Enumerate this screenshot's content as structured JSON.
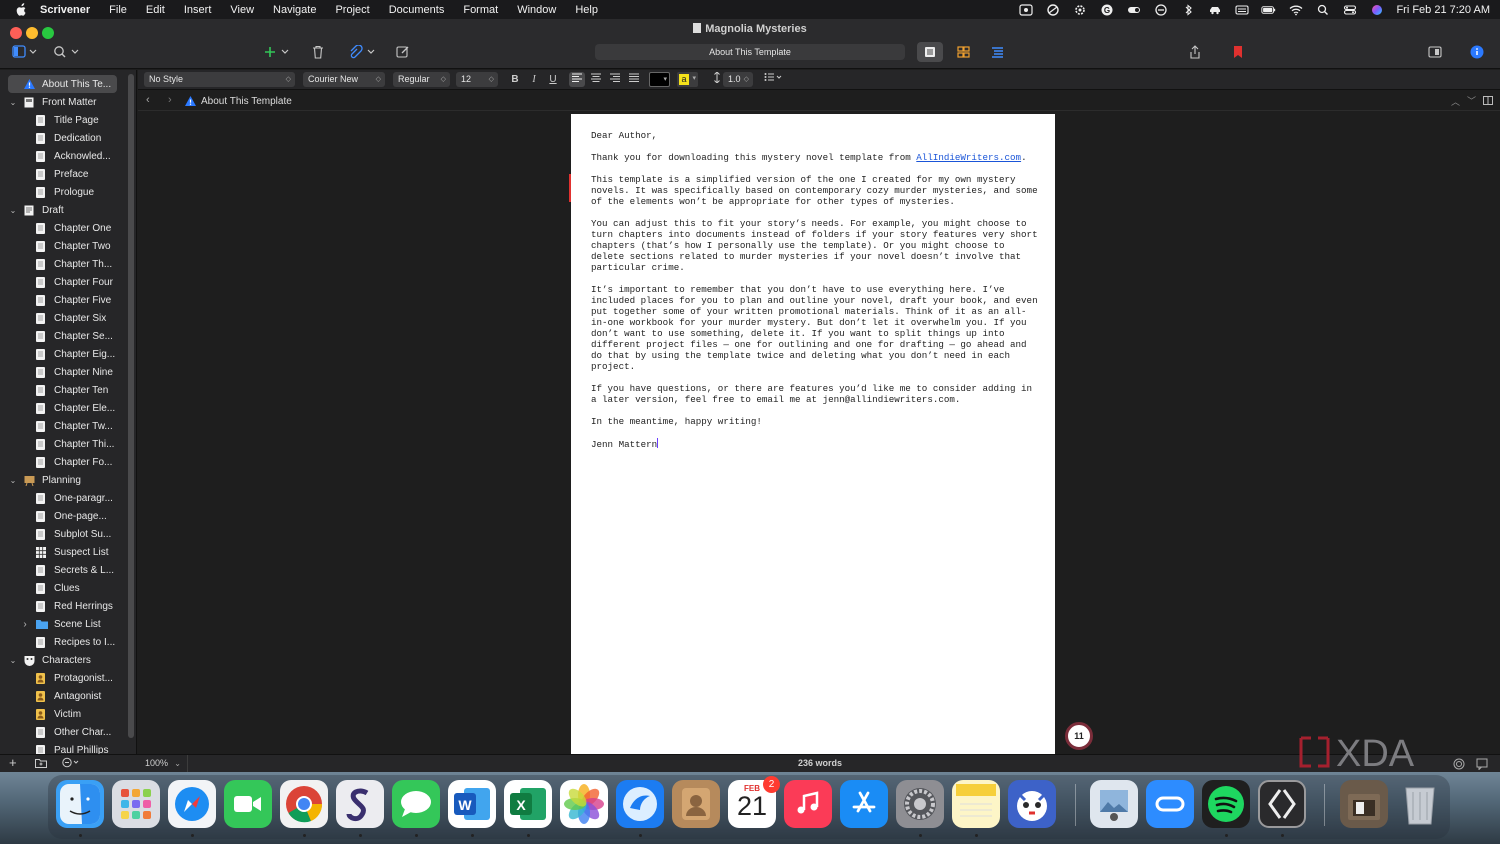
{
  "menubar": {
    "app_name": "Scrivener",
    "items": [
      "File",
      "Edit",
      "Insert",
      "View",
      "Navigate",
      "Project",
      "Documents",
      "Format",
      "Window",
      "Help"
    ],
    "clock": "Fri Feb 21  7:20 AM"
  },
  "window": {
    "title": "Magnolia Mysteries",
    "document_title": "About This Template"
  },
  "binder": {
    "items": [
      {
        "label": "About This Te...",
        "level": 0,
        "selected": true,
        "icon": "about-icon"
      },
      {
        "label": "Front Matter",
        "level": 0,
        "expanded": true,
        "icon": "folder-icon"
      },
      {
        "label": "Title Page",
        "level": 1,
        "icon": "document-icon"
      },
      {
        "label": "Dedication",
        "level": 1,
        "icon": "document-icon"
      },
      {
        "label": "Acknowled...",
        "level": 1,
        "icon": "document-icon"
      },
      {
        "label": "Preface",
        "level": 1,
        "icon": "document-icon"
      },
      {
        "label": "Prologue",
        "level": 1,
        "icon": "document-icon"
      },
      {
        "label": "Draft",
        "level": 0,
        "expanded": true,
        "icon": "draft-icon"
      },
      {
        "label": "Chapter One",
        "level": 1,
        "icon": "document-icon"
      },
      {
        "label": "Chapter Two",
        "level": 1,
        "icon": "document-icon"
      },
      {
        "label": "Chapter Th...",
        "level": 1,
        "icon": "document-icon"
      },
      {
        "label": "Chapter Four",
        "level": 1,
        "icon": "document-icon"
      },
      {
        "label": "Chapter Five",
        "level": 1,
        "icon": "document-icon"
      },
      {
        "label": "Chapter Six",
        "level": 1,
        "icon": "document-icon"
      },
      {
        "label": "Chapter Se...",
        "level": 1,
        "icon": "document-icon"
      },
      {
        "label": "Chapter Eig...",
        "level": 1,
        "icon": "document-icon"
      },
      {
        "label": "Chapter Nine",
        "level": 1,
        "icon": "document-icon"
      },
      {
        "label": "Chapter Ten",
        "level": 1,
        "icon": "document-icon"
      },
      {
        "label": "Chapter Ele...",
        "level": 1,
        "icon": "document-icon"
      },
      {
        "label": "Chapter Tw...",
        "level": 1,
        "icon": "document-icon"
      },
      {
        "label": "Chapter Thi...",
        "level": 1,
        "icon": "document-icon"
      },
      {
        "label": "Chapter Fo...",
        "level": 1,
        "icon": "document-icon"
      },
      {
        "label": "Planning",
        "level": 0,
        "expanded": true,
        "icon": "planning-icon"
      },
      {
        "label": "One-paragr...",
        "level": 1,
        "icon": "document-icon"
      },
      {
        "label": "One-page...",
        "level": 1,
        "icon": "document-icon"
      },
      {
        "label": "Subplot Su...",
        "level": 1,
        "icon": "document-icon"
      },
      {
        "label": "Suspect List",
        "level": 1,
        "icon": "grid-document-icon"
      },
      {
        "label": "Secrets & L...",
        "level": 1,
        "icon": "document-icon"
      },
      {
        "label": "Clues",
        "level": 1,
        "icon": "document-icon"
      },
      {
        "label": "Red Herrings",
        "level": 1,
        "icon": "document-icon"
      },
      {
        "label": "Scene List",
        "level": 1,
        "collapsed": true,
        "icon": "blue-folder-icon"
      },
      {
        "label": "Recipes to I...",
        "level": 1,
        "icon": "document-icon"
      },
      {
        "label": "Characters",
        "level": 0,
        "expanded": true,
        "icon": "characters-icon"
      },
      {
        "label": "Protagonist...",
        "level": 1,
        "icon": "character-sheet-icon"
      },
      {
        "label": "Antagonist",
        "level": 1,
        "icon": "character-sheet-icon"
      },
      {
        "label": "Victim",
        "level": 1,
        "icon": "character-sheet-icon"
      },
      {
        "label": "Other Char...",
        "level": 1,
        "icon": "document-icon"
      },
      {
        "label": "Paul Phillips",
        "level": 1,
        "icon": "document-icon"
      }
    ]
  },
  "format_bar": {
    "style": "No Style",
    "font": "Courier New",
    "weight": "Regular",
    "size": "12",
    "line_spacing": "1.0",
    "highlight_label": "a"
  },
  "header": {
    "title": "About This Template"
  },
  "document": {
    "paragraphs": [
      {
        "text": "Dear Author,"
      },
      {
        "text": "Thank you for downloading this mystery novel template from ",
        "link": "AllIndieWriters.com",
        "after": "."
      },
      {
        "text": "This template is a simplified version of the one I created for my own mystery novels. It was specifically based on contemporary cozy murder mysteries, and some of the elements won’t be appropriate for other types of mysteries."
      },
      {
        "text": "You can adjust this to fit your story’s needs. For example, you might choose to turn chapters into documents instead of folders if your story features very short chapters (that’s how I personally use the template). Or you might choose to delete sections related to murder mysteries if your novel doesn’t involve that particular crime."
      },
      {
        "text": "It’s important to remember that you don’t have to use everything here. I’ve included places for you to plan and outline your novel, draft your book, and even put together some of your written promotional materials. Think of it as an all-in-one workbook for your murder mystery. But don’t let it overwhelm you. If you don’t want to use something, delete it. If you want to split things up into different project files — one for outlining and one for drafting — go ahead and do that by using the template twice and deleting what you don’t need in each project."
      },
      {
        "text": "If you have questions, or there are features you’d like me to consider adding in a later version, feel free to email me at jenn@allindiewriters.com."
      },
      {
        "text": "In the meantime, happy writing!"
      },
      {
        "text": "Jenn Mattern"
      }
    ]
  },
  "footer": {
    "zoom": "100%",
    "word_count": "236 words"
  },
  "badge_count": "11",
  "watermark": "XDA",
  "dock": {
    "calendar_month": "FEB",
    "calendar_day": "21",
    "calendar_badge": "2",
    "apps": [
      "finder-icon",
      "launchpad-icon",
      "safari-icon",
      "facetime-icon",
      "chrome-icon",
      "scrivener-icon",
      "messages-icon",
      "word-icon",
      "excel-icon",
      "photos-icon",
      "mail-icon",
      "contacts-icon",
      "calendar-icon",
      "music-icon",
      "app-store-icon",
      "system-settings-icon",
      "notes-icon",
      "bitwarden-icon",
      "preview-icon",
      "zoom-icon",
      "spotify-icon",
      "xda-app-icon",
      "downloads-icon",
      "trash-icon"
    ]
  },
  "colors": {
    "accent": "#2b79ff",
    "link": "#1a55d8",
    "bookmark": "#e0312f"
  }
}
